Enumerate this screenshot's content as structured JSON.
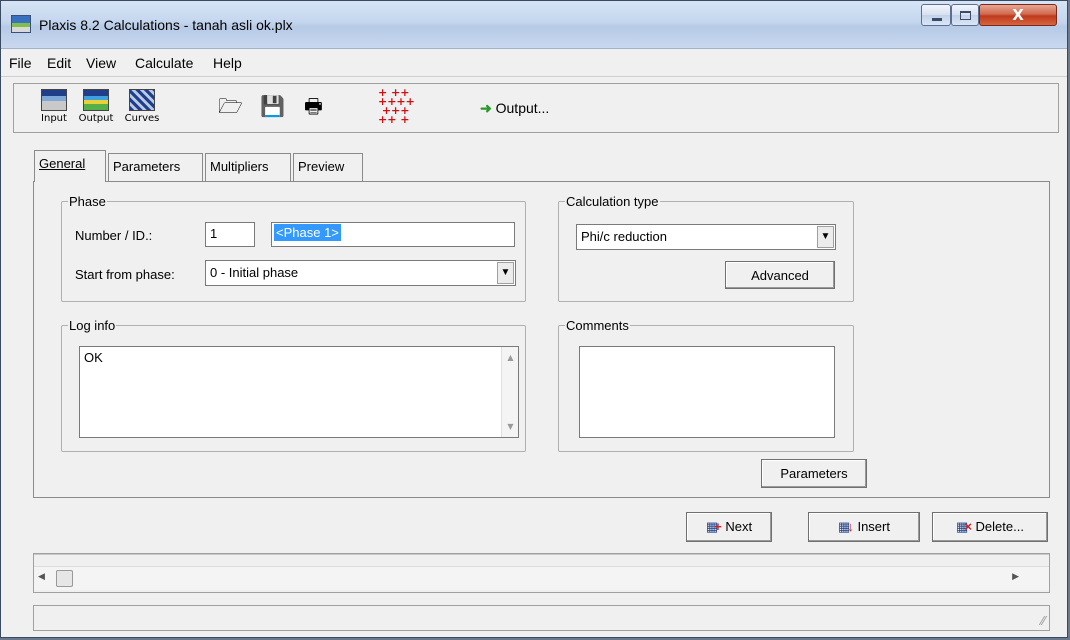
{
  "window": {
    "title": "Plaxis 8.2 Calculations - tanah asli ok.plx",
    "close_glyph": "X"
  },
  "menu": [
    "File",
    "Edit",
    "View",
    "Calculate",
    "Help"
  ],
  "toolbar": {
    "input_label": "Input",
    "output_label": "Output",
    "curves_label": "Curves",
    "output_button_label": "Output...",
    "icons": [
      "open-folder-icon",
      "save-icon",
      "print-icon",
      "select-points-icon"
    ]
  },
  "tabs": [
    "General",
    "Parameters",
    "Multipliers",
    "Preview"
  ],
  "phase": {
    "group_label": "Phase",
    "number_label": "Number / ID.:",
    "number_value": "1",
    "id_value": "<Phase 1>",
    "start_from_label": "Start from phase:",
    "start_from_value": "0 - Initial phase"
  },
  "calculation_type": {
    "group_label": "Calculation type",
    "value": "Phi/c reduction",
    "advanced_label": "Advanced"
  },
  "log_info": {
    "group_label": "Log info",
    "text": "OK"
  },
  "comments": {
    "group_label": "Comments",
    "text": ""
  },
  "buttons": {
    "parameters": "Parameters",
    "next": "Next",
    "insert": "Insert",
    "delete": "Delete..."
  },
  "colors": {
    "accent_selection": "#3399ff",
    "next_icon": "#cc2020",
    "output_arrow": "#2a9a2a"
  }
}
